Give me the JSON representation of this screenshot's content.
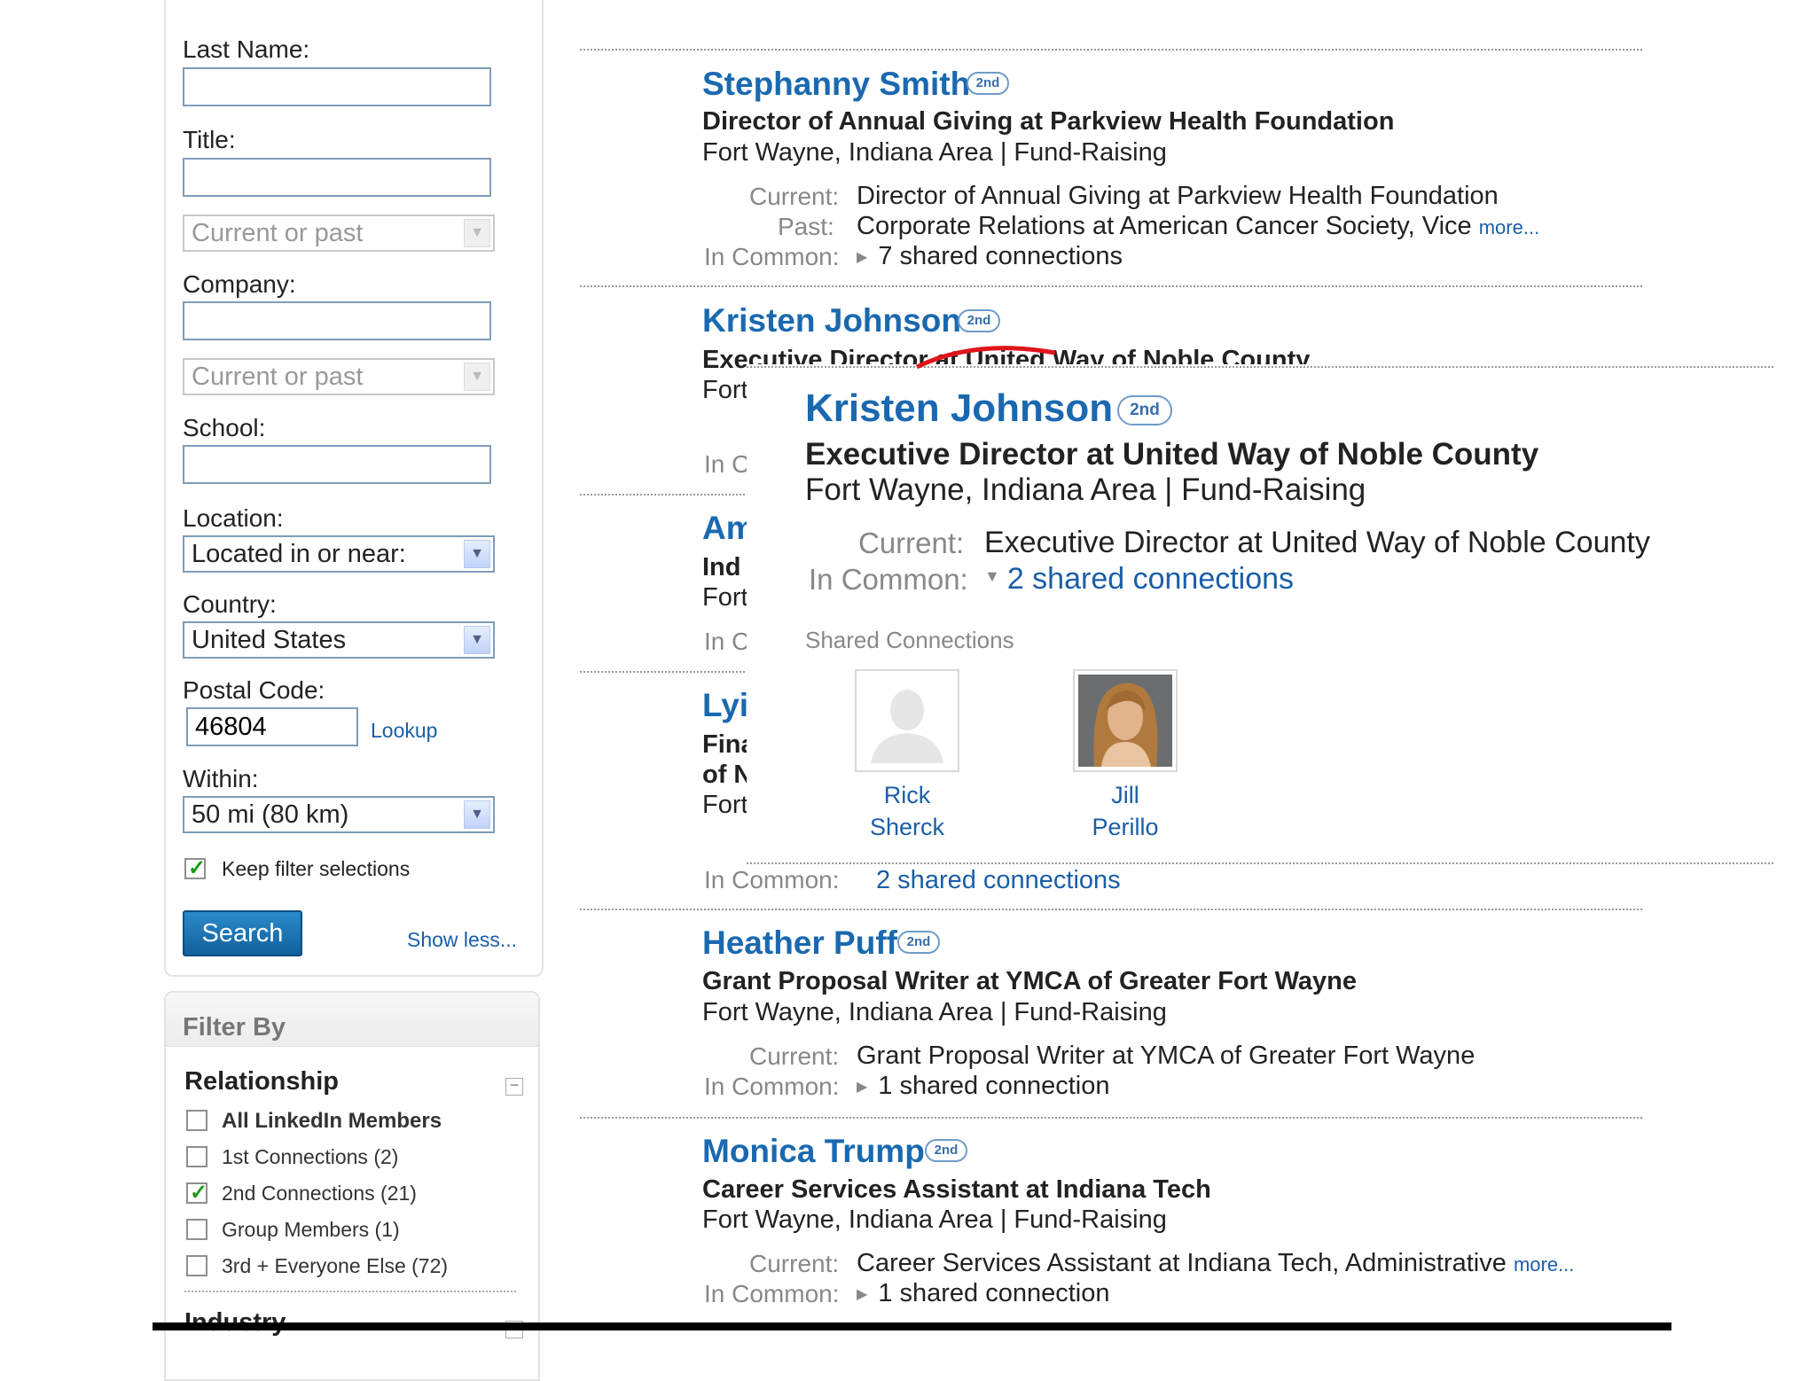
{
  "search_form": {
    "last_name_label": "Last Name:",
    "title_label": "Title:",
    "title_scope_placeholder": "Current or past",
    "company_label": "Company:",
    "company_scope_placeholder": "Current or past",
    "school_label": "School:",
    "location_label": "Location:",
    "location_value": "Located in or near:",
    "country_label": "Country:",
    "country_value": "United States",
    "postal_code_label": "Postal Code:",
    "postal_code_value": "46804",
    "lookup_link": "Lookup",
    "within_label": "Within:",
    "within_value": "50 mi (80 km)",
    "keep_filters_label": "Keep filter selections",
    "keep_filters_checked": true,
    "search_button": "Search",
    "show_less_link": "Show less..."
  },
  "filter_by": {
    "title": "Filter By",
    "relationship_heading": "Relationship",
    "options": [
      {
        "label": "All LinkedIn Members",
        "checked": false,
        "bold": true
      },
      {
        "label": "1st Connections (2)",
        "checked": false
      },
      {
        "label": "2nd Connections (21)",
        "checked": true
      },
      {
        "label": "Group Members (1)",
        "checked": false
      },
      {
        "label": "3rd + Everyone Else (72)",
        "checked": false
      }
    ],
    "industry_heading": "Industry"
  },
  "labels": {
    "current": "Current:",
    "past": "Past:",
    "in_common": "In Common:",
    "more": "more...",
    "degree": "2nd"
  },
  "results": [
    {
      "name": "Stephanny Smith",
      "headline": "Director of Annual Giving at Parkview Health Foundation",
      "location": "Fort Wayne, Indiana Area | Fund-Raising",
      "current": "Director of Annual Giving at Parkview Health Foundation",
      "past": "Corporate Relations at American Cancer Society, Vice",
      "in_common": "7 shared connections"
    },
    {
      "name": "Kristen Johnson",
      "headline": "Executive Director at United Way of Noble County",
      "location_partial": "Fort",
      "in_common_partial": "In C"
    },
    {
      "name_partial": "Am",
      "headline_partial": "Ind",
      "location_partial": "Fort",
      "in_common_partial": "In C"
    },
    {
      "name_partial": "Lyi",
      "headline_partial": "Fina",
      "headline_partial_2": "of N",
      "location_partial": "Fort",
      "in_common_partial": "In Common:",
      "in_common_value_partial": "2 shared connections"
    },
    {
      "name": "Heather Puff",
      "headline": "Grant Proposal Writer at YMCA of Greater Fort Wayne",
      "location": "Fort Wayne, Indiana Area | Fund-Raising",
      "current": "Grant Proposal Writer at YMCA of Greater Fort Wayne",
      "in_common": "1 shared connection"
    },
    {
      "name": "Monica Trump",
      "headline": "Career Services Assistant at Indiana Tech",
      "location": "Fort Wayne, Indiana Area | Fund-Raising",
      "current": "Career Services Assistant at Indiana Tech, Administrative",
      "in_common": "1 shared connection"
    }
  ],
  "popup": {
    "name": "Kristen Johnson",
    "headline": "Executive Director at United Way of Noble County",
    "location": "Fort Wayne, Indiana Area | Fund-Raising",
    "current": "Executive Director at United Way of Noble County",
    "in_common": "2 shared connections",
    "shared_heading": "Shared Connections",
    "connections": [
      {
        "first": "Rick",
        "last": "Sherck",
        "has_photo": false
      },
      {
        "first": "Jill",
        "last": "Perillo",
        "has_photo": true
      }
    ]
  },
  "colors": {
    "link_blue": "#1a69b0",
    "label_gray": "#888888",
    "check_green": "#169b16",
    "button_blue": "#11609c",
    "annotation_red": "#e0151b"
  }
}
